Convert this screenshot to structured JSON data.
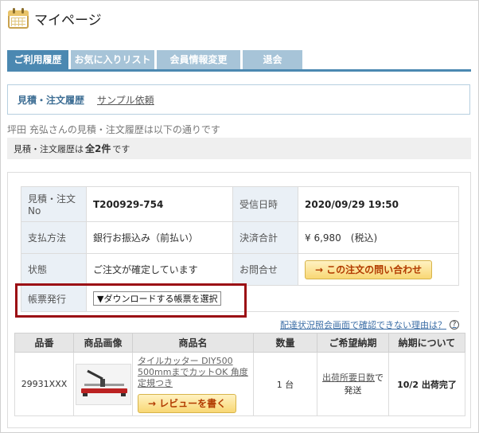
{
  "header": {
    "title": "マイページ"
  },
  "tabs": [
    {
      "label": "ご利用履歴",
      "active": true
    },
    {
      "label": "お気に入りリスト",
      "active": false
    },
    {
      "label": "会員情報変更",
      "active": false
    },
    {
      "label": "退会",
      "active": false
    }
  ],
  "subnav": {
    "history": "見積・注文履歴",
    "sample": "サンプル依頼"
  },
  "history_note": "坪田 充弘さんの見積・注文履歴は以下の通りです",
  "count": {
    "prefix": "見積・注文履歴は",
    "value": "全2件",
    "suffix": "です"
  },
  "order": {
    "no_label": "見積・注文No",
    "no_value": "T200929-754",
    "received_label": "受信日時",
    "received_value": "2020/09/29 19:50",
    "payment_label": "支払方法",
    "payment_value": "銀行お振込み（前払い）",
    "total_label": "決済合計",
    "total_value": "¥ 6,980　(税込)",
    "status_label": "状態",
    "status_value": "ご注文が確定しています",
    "inquiry_label": "お問合せ",
    "inquiry_button": "この注文の問い合わせ",
    "voucher_label": "帳票発行",
    "voucher_select": "▼ダウンロードする帳票を選択"
  },
  "status_link": "配達状況照会画面で確認できない理由は？",
  "items_table": {
    "headers": [
      "品番",
      "商品画像",
      "商品名",
      "数量",
      "ご希望納期",
      "納期について"
    ],
    "rows": [
      {
        "code": "29931XXX",
        "name": "タイルカッター DIY500 500mmまでカットOK 角度定規つき",
        "review_button": "レビューを書く",
        "qty": "1 台",
        "delivery_link": "出荷所要日数",
        "delivery_suffix": "で発送",
        "delivery_status": "10/2 出荷完了"
      }
    ]
  }
}
